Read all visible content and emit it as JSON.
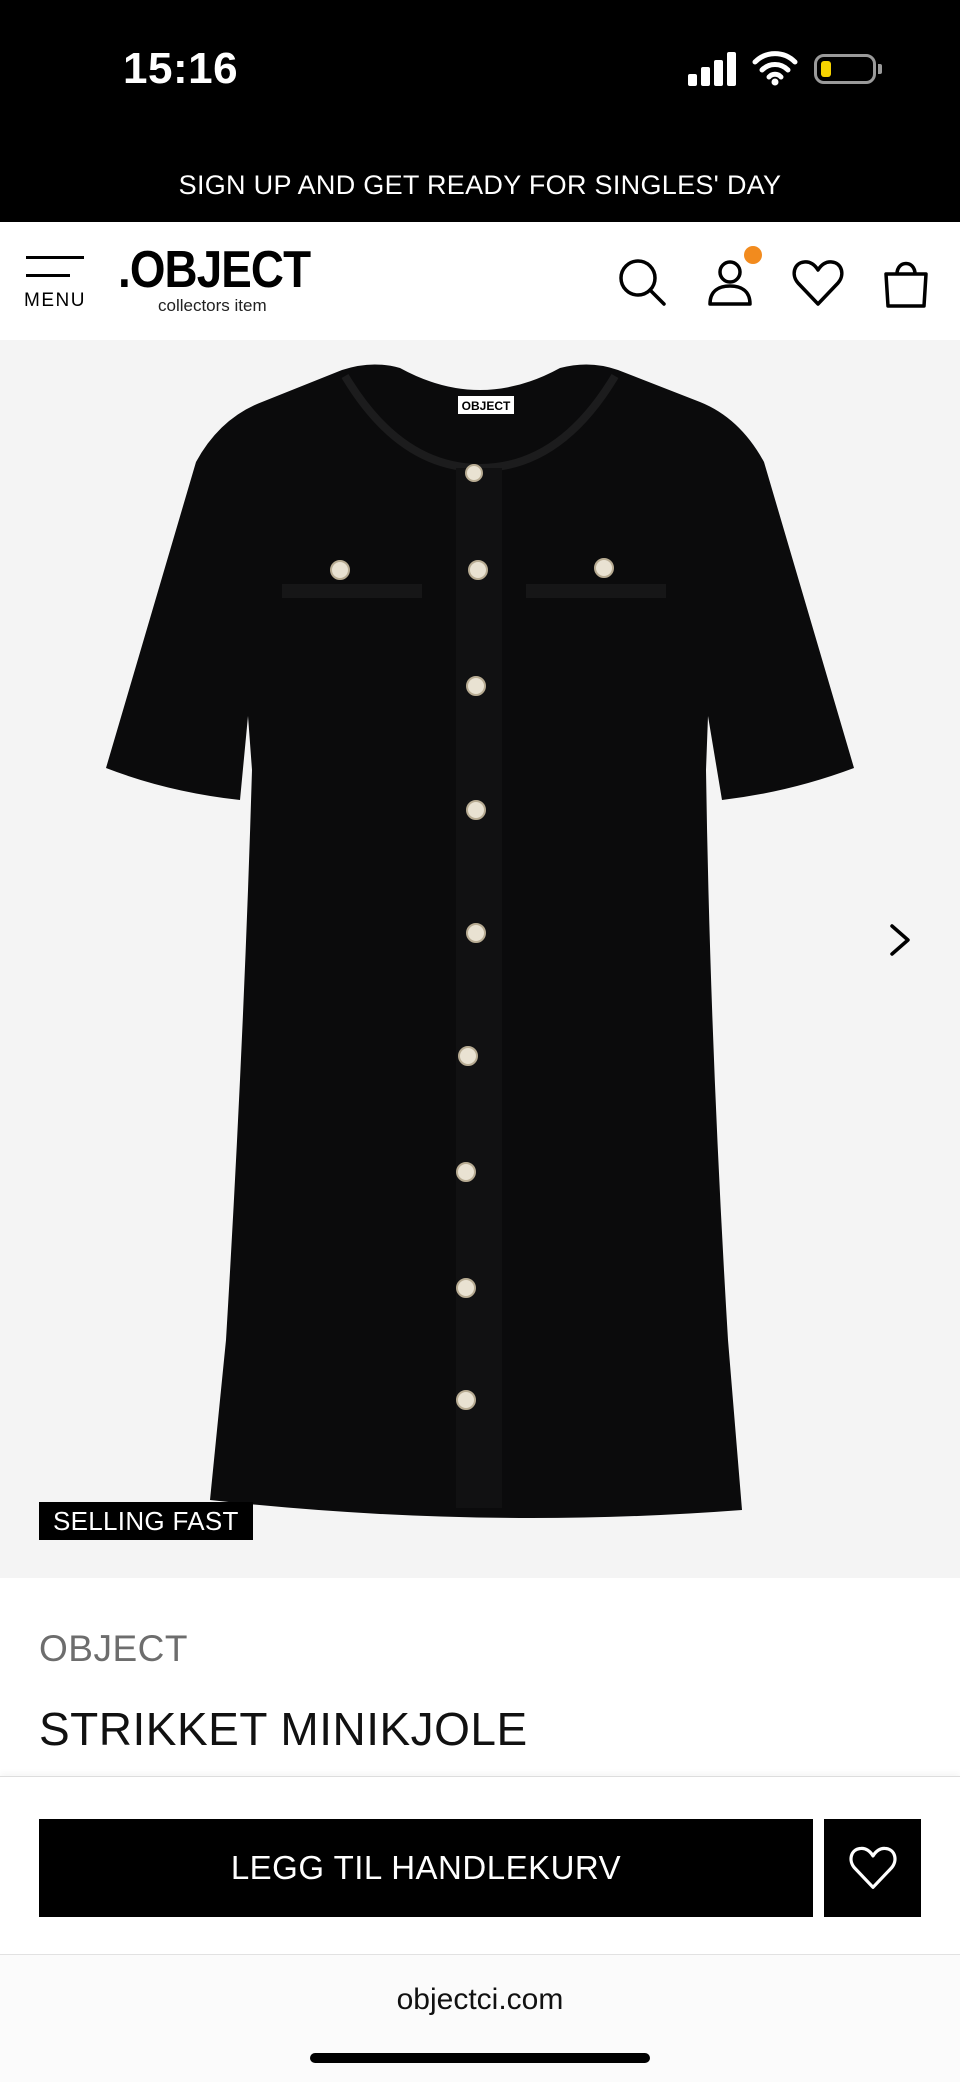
{
  "status_bar": {
    "time": "15:16"
  },
  "promo": {
    "text": "SIGN UP AND GET READY FOR SINGLES' DAY"
  },
  "header": {
    "menu_label": "MENU",
    "logo_wordmark": ".OBJECT",
    "logo_tagline": "collectors item",
    "icons": [
      "search-icon",
      "account-icon",
      "wishlist-icon",
      "bag-icon"
    ],
    "notification_color": "#f28b1e"
  },
  "product": {
    "badge": "SELLING FAST",
    "brand": "OBJECT",
    "name": "STRIKKET MINIKJOLE",
    "image_description": "black short-sleeve knitted mini dress with pearl buttons"
  },
  "actions": {
    "add_to_cart": "LEGG TIL HANDLEKURV"
  },
  "browser": {
    "url": "objectci.com"
  }
}
